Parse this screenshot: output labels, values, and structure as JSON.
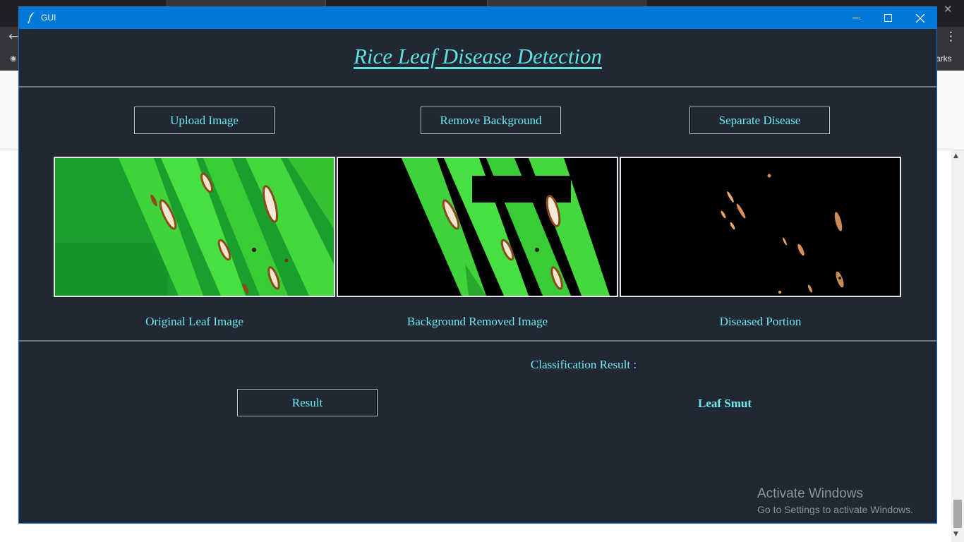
{
  "window": {
    "title": "GUI",
    "icon": "feather-icon",
    "controls": [
      "minimize-icon",
      "maximize-icon",
      "close-icon"
    ]
  },
  "app": {
    "heading": "Rice Leaf Disease Detection"
  },
  "toolbar": {
    "upload_label": "Upload Image",
    "remove_bg_label": "Remove Background",
    "separate_label": "Separate Disease"
  },
  "panels": {
    "original_caption": "Original Leaf Image",
    "bg_removed_caption": "Background Removed Image",
    "diseased_caption": "Diseased Portion"
  },
  "classification": {
    "label": "Classification Result :",
    "button_label": "Result",
    "value": "Leaf Smut"
  },
  "watermark": {
    "title": "Activate Windows",
    "subtitle": "Go to Settings to activate Windows."
  },
  "background_browser": {
    "bookmarks_fragment": "arks"
  },
  "colors": {
    "window_bg": "#212834",
    "titlebar": "#0078d7",
    "accent_text": "#6fe8ee",
    "leaf_green": "#2fbf3a"
  }
}
